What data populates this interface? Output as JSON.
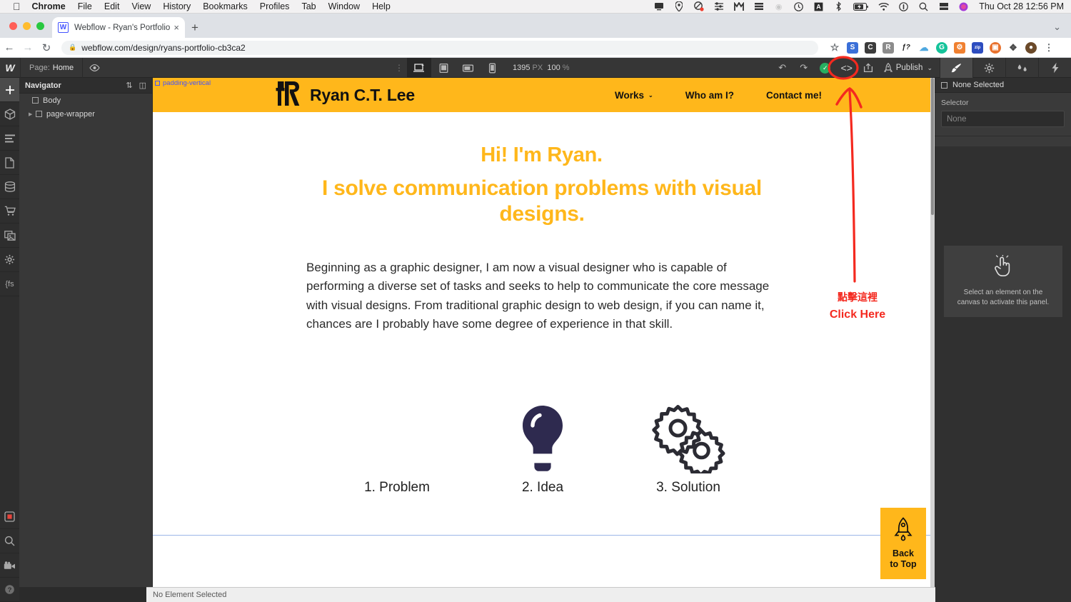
{
  "macos": {
    "apple_icon": "apple-logo",
    "menus": [
      "Chrome",
      "File",
      "Edit",
      "View",
      "History",
      "Bookmarks",
      "Profiles",
      "Tab",
      "Window",
      "Help"
    ],
    "status_icons": [
      "display-icon",
      "location-icon",
      "shield-icon",
      "network-tuning-icon",
      "malwarebytes-icon",
      "stack-icon",
      "dropbox-icon",
      "timemachine-icon",
      "character-input-icon",
      "bluetooth-icon",
      "battery-icon",
      "wifi-icon",
      "control-center-icon",
      "spotlight-search-icon",
      "screen-sharing-icon",
      "siri-icon"
    ],
    "clock": "Thu Oct 28  12:56 PM"
  },
  "browser": {
    "tab_title": "Webflow - Ryan's Portfolio",
    "favicon_letter": "W",
    "close_tab": "×",
    "new_tab": "+",
    "maximize": "⌄",
    "back": "←",
    "forward": "→",
    "reload": "↻",
    "lock_icon": "lock-icon",
    "url": "webflow.com/design/ryans-portfolio-cb3ca2",
    "bookmark_star": "☆",
    "extensions": [
      {
        "name": "sketch-extension",
        "letter": "S",
        "color": "#3a6fd8"
      },
      {
        "name": "cite-extension",
        "letter": "C",
        "color": "#3c3c3c"
      },
      {
        "name": "readwise-extension",
        "letter": "R",
        "color": "#8c8c8c"
      },
      {
        "name": "fontface-ninja-extension",
        "letter": "ƒ?",
        "color": "#ffffff"
      },
      {
        "name": "cloud-extension",
        "letter": "☁",
        "color": "#4fa8e0"
      },
      {
        "name": "grammarly-extension",
        "letter": "G",
        "color": "#15c39a"
      },
      {
        "name": "orange-tool-extension",
        "letter": "⚙",
        "color": "#f08030"
      },
      {
        "name": "zip-extension",
        "letter": "zip",
        "color": "#2d4dbf"
      },
      {
        "name": "image-extension",
        "letter": "▣",
        "color": "#e8722e"
      },
      {
        "name": "puzzle-extensions-icon",
        "letter": "❖",
        "color": "#4a4a4a"
      },
      {
        "name": "profile-avatar",
        "letter": "●",
        "color": "#6b4a2a"
      }
    ],
    "overflow_menu": "⋮"
  },
  "webflow_topbar": {
    "logo": "webflow-logo",
    "page_label": "Page:",
    "page_name": "Home",
    "preview_icon": "eye-icon",
    "drag_handle": "⋮",
    "devices": [
      {
        "name": "desktop-breakpoint",
        "glyph": "💻",
        "active": true
      },
      {
        "name": "tablet-breakpoint",
        "glyph": "▣",
        "active": false
      },
      {
        "name": "tablet-landscape-breakpoint",
        "glyph": "▭",
        "active": false
      },
      {
        "name": "mobile-breakpoint",
        "glyph": "▯",
        "active": false
      }
    ],
    "canvas_width": "1395",
    "canvas_width_unit": "PX",
    "zoom": "100",
    "zoom_unit": "%",
    "undo": "↶",
    "redo": "↷",
    "save_status": "✓",
    "code_icon": "code-embed-icon",
    "export_icon": "export-icon",
    "publish_rocket": "rocket-icon",
    "publish_label": "Publish",
    "publish_caret": "⌄",
    "panel_tabs": [
      {
        "name": "style-panel-tab",
        "glyph": "🖌",
        "active": true
      },
      {
        "name": "settings-panel-tab",
        "glyph": "⚙",
        "active": false
      },
      {
        "name": "interactions-panel-tab",
        "glyph": "●●",
        "active": false
      },
      {
        "name": "effects-panel-tab",
        "glyph": "⚡",
        "active": false
      }
    ]
  },
  "rail": {
    "items": [
      {
        "name": "add-elements-icon",
        "glyph": "+",
        "selected": true
      },
      {
        "name": "components-icon",
        "glyph": "⬡",
        "selected": false
      },
      {
        "name": "navigator-icon",
        "glyph": "☰",
        "selected": false
      },
      {
        "name": "pages-icon",
        "glyph": "◧",
        "selected": false
      },
      {
        "name": "cms-icon",
        "glyph": "≡",
        "selected": false
      },
      {
        "name": "ecommerce-icon",
        "glyph": "⛺",
        "selected": false
      },
      {
        "name": "assets-icon",
        "glyph": "▦",
        "selected": false
      },
      {
        "name": "settings-icon",
        "glyph": "⚙",
        "selected": false
      },
      {
        "name": "finsweet-icon",
        "glyph": "{fs",
        "selected": false
      }
    ],
    "bottom_items": [
      {
        "name": "stop-recording-icon",
        "glyph": "■"
      },
      {
        "name": "search-icon",
        "glyph": "⚲"
      },
      {
        "name": "video-tutorials-icon",
        "glyph": "🎥"
      },
      {
        "name": "help-icon",
        "glyph": "?"
      }
    ]
  },
  "navigator": {
    "title": "Navigator",
    "sort_icon": "sort-icon",
    "collapse_icon": "panel-collapse-icon",
    "tree": [
      {
        "label": "Body",
        "level": 1,
        "caret": ""
      },
      {
        "label": "page-wrapper",
        "level": 2,
        "caret": "▶"
      }
    ]
  },
  "canvas": {
    "padding_badge": "padding-vertical",
    "site": {
      "logo_mark": "ryan-monogram-logo",
      "brand_name": "Ryan C.T. Lee",
      "nav": [
        {
          "label": "Works",
          "caret": "⌄"
        },
        {
          "label": "Who am I?",
          "caret": ""
        },
        {
          "label": "Contact me!",
          "caret": ""
        }
      ],
      "heading1": "Hi! I'm Ryan.",
      "heading2": "I solve communication problems with visual designs.",
      "paragraph": "Beginning as a graphic designer, I am now a visual designer who is capable of performing a diverse set of tasks and seeks to help to communicate the core message with visual designs. From traditional graphic design to web design, if you can name it, chances are I probably have some degree of experience in that skill.",
      "steps": [
        {
          "label": "1. Problem",
          "icon": "none"
        },
        {
          "label": "2. Idea",
          "icon": "lightbulb-icon"
        },
        {
          "label": "3. Solution",
          "icon": "gears-icon"
        }
      ],
      "back_to_top": {
        "icon": "rocket-icon",
        "line1": "Back",
        "line2": "to Top"
      }
    }
  },
  "annotation": {
    "chinese": "點擊這裡",
    "english": "Click Here",
    "color": "#f4291f"
  },
  "right_panel": {
    "header": "None Selected",
    "selector_label": "Selector",
    "selector_value": "",
    "selector_placeholder": "None",
    "empty_icon": "pointer-hand-icon",
    "empty_message": "Select an element on the canvas to activate this panel."
  },
  "status_bar": {
    "text": "No Element Selected"
  },
  "theme": {
    "brand_yellow": "#ffb71b",
    "webflow_blue": "#4353ff",
    "annotation_red": "#f4291f",
    "bulb_purple": "#2e2a4f"
  }
}
